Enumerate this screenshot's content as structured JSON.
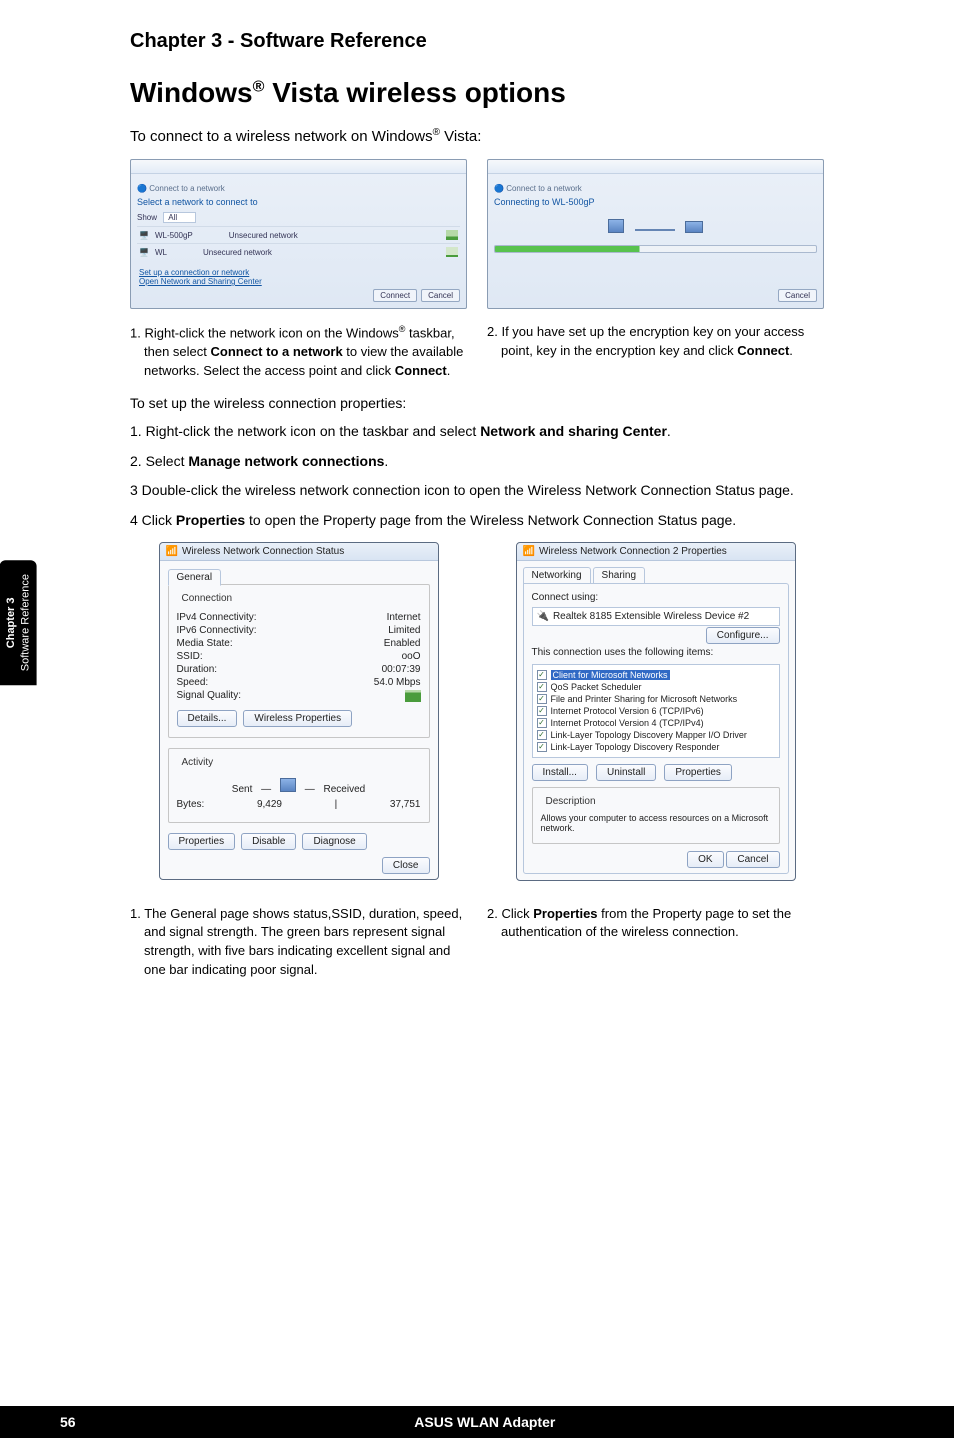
{
  "chapter_heading": "Chapter 3 - Software Reference",
  "main_title_pre": "Windows",
  "main_title_sup": "®",
  "main_title_post": " Vista wireless options",
  "intro_pre": "To connect to a wireless network on Windows",
  "intro_sup": "®",
  "intro_post": " Vista:",
  "side_tab": {
    "line1": "Chapter 3",
    "line2": "Software Reference"
  },
  "win1": {
    "title": "Connect to a network",
    "subtitle": "Select a network to connect to",
    "show_label": "Show",
    "show_value": "All",
    "rows": [
      {
        "name": "WL-500gP",
        "desc": "Unsecured network"
      },
      {
        "name": "WL",
        "desc": "Unsecured network"
      }
    ],
    "link1": "Set up a connection or network",
    "link2": "Open Network and Sharing Center",
    "btn_connect": "Connect",
    "btn_cancel": "Cancel"
  },
  "win2": {
    "title": "Connect to a network",
    "subtitle": "Connecting to WL-500gP",
    "btn_cancel": "Cancel"
  },
  "step1_a": "1. Right-click the network icon on the Windows",
  "step1_sup": "®",
  "step1_b": " taskbar, then select ",
  "step1_bold1": "Connect to a network",
  "step1_c": " to view the available networks. Select the access point and click ",
  "step1_bold2": "Connect",
  "step1_d": ".",
  "step2_a": "2. If you have set up the encryption key on your access point, key in the encryption key and click ",
  "step2_bold": "Connect",
  "step2_b": ".",
  "setup_para": "To set up the wireless connection properties:",
  "setup_steps": {
    "s1a": "1. Right-click the network icon on the taskbar and select ",
    "s1b": "Network and sharing Center",
    "s1c": ".",
    "s2a": "2. Select ",
    "s2b": "Manage network connections",
    "s2c": ".",
    "s3": "3  Double-click the wireless network connection icon to open the Wireless Network Connection Status page.",
    "s4a": "4 Click ",
    "s4b": "Properties",
    "s4c": " to open the Property page from the Wireless Network Connection Status page."
  },
  "status_dialog": {
    "title": "Wireless Network Connection Status",
    "tab": "General",
    "legend1": "Connection",
    "rows": [
      {
        "k": "IPv4 Connectivity:",
        "v": "Internet"
      },
      {
        "k": "IPv6 Connectivity:",
        "v": "Limited"
      },
      {
        "k": "Media State:",
        "v": "Enabled"
      },
      {
        "k": "SSID:",
        "v": "ooO"
      },
      {
        "k": "Duration:",
        "v": "00:07:39"
      },
      {
        "k": "Speed:",
        "v": "54.0 Mbps"
      },
      {
        "k": "Signal Quality:",
        "v": ""
      }
    ],
    "btn_details": "Details...",
    "btn_wprops": "Wireless Properties",
    "legend2": "Activity",
    "sent": "Sent",
    "received": "Received",
    "bytes_label": "Bytes:",
    "bytes_sent": "9,429",
    "bytes_recv": "37,751",
    "btn_props": "Properties",
    "btn_disable": "Disable",
    "btn_diag": "Diagnose",
    "btn_close": "Close"
  },
  "prop_dialog": {
    "title": "Wireless Network Connection 2 Properties",
    "tabs": {
      "t1": "Networking",
      "t2": "Sharing"
    },
    "connect_using": "Connect using:",
    "adapter": "Realtek 8185 Extensible Wireless Device #2",
    "btn_configure": "Configure...",
    "uses_label": "This connection uses the following items:",
    "items": [
      "Client for Microsoft Networks",
      "QoS Packet Scheduler",
      "File and Printer Sharing for Microsoft Networks",
      "Internet Protocol Version 6 (TCP/IPv6)",
      "Internet Protocol Version 4 (TCP/IPv4)",
      "Link-Layer Topology Discovery Mapper I/O Driver",
      "Link-Layer Topology Discovery Responder"
    ],
    "btn_install": "Install...",
    "btn_uninstall": "Uninstall",
    "btn_properties": "Properties",
    "desc_legend": "Description",
    "desc_text": "Allows your computer to access resources on a Microsoft network.",
    "btn_ok": "OK",
    "btn_cancel": "Cancel"
  },
  "bottom_step1": "1. The General page shows status,SSID, duration, speed, and signal strength. The green bars represent signal strength, with five bars indicating excellent signal and one bar indicating poor signal.",
  "bottom_step2_a": "2. Click ",
  "bottom_step2_bold": "Properties",
  "bottom_step2_b": " from the Property page to set the authentication of the wireless connection.",
  "footer": {
    "page_num": "56",
    "product": "ASUS WLAN Adapter"
  }
}
